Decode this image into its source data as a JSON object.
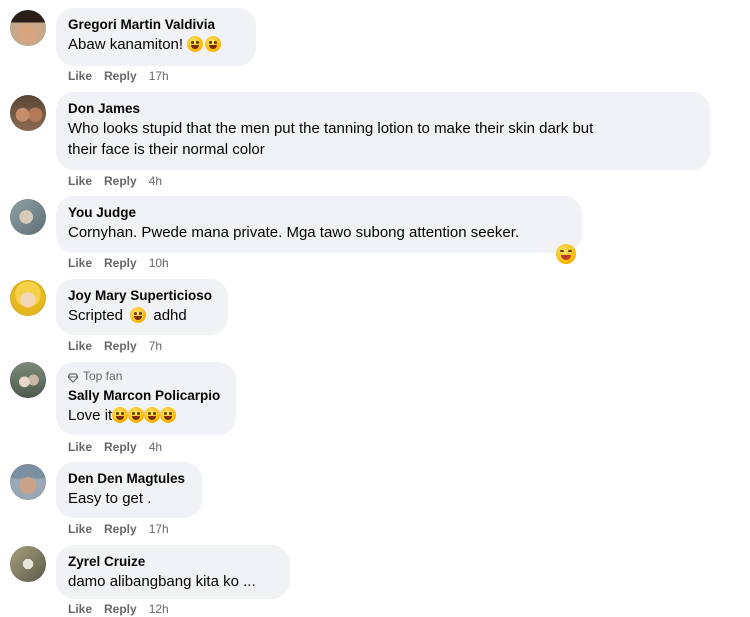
{
  "actions": {
    "like": "Like",
    "reply": "Reply"
  },
  "comments": [
    {
      "author": "Gregori Martin Valdivia",
      "text": "Abaw kanamiton!",
      "emoji": [
        "grinning-squint-icon",
        "laughing-icon"
      ],
      "time": "17h"
    },
    {
      "author": "Don James",
      "line1": "Who looks stupid that the men put the tanning lotion to make their skin dark but",
      "line2": "their face is their normal color",
      "time": "4h"
    },
    {
      "author": "You Judge",
      "text": "Cornyhan. Pwede mana private. Mga tawo subong attention seeker.",
      "reaction": "haha-reaction-icon",
      "time": "10h"
    },
    {
      "author": "Joy Mary Superticioso",
      "text_before": "Scripted",
      "text_after": "adhd",
      "emoji": [
        "grin-icon"
      ],
      "time": "7h"
    },
    {
      "badge": "Top fan",
      "author": "Sally Marcon Policarpio",
      "text": "Love it",
      "emoji": [
        "rofl-icon",
        "rofl-icon",
        "rofl-icon",
        "rofl-icon"
      ],
      "time": "4h"
    },
    {
      "author": "Den Den Magtules",
      "text": "Easy to get .",
      "time": "17h"
    },
    {
      "author": "Zyrel Cruize",
      "text": "damo alibangbang kita ko ...",
      "time": "12h"
    }
  ]
}
